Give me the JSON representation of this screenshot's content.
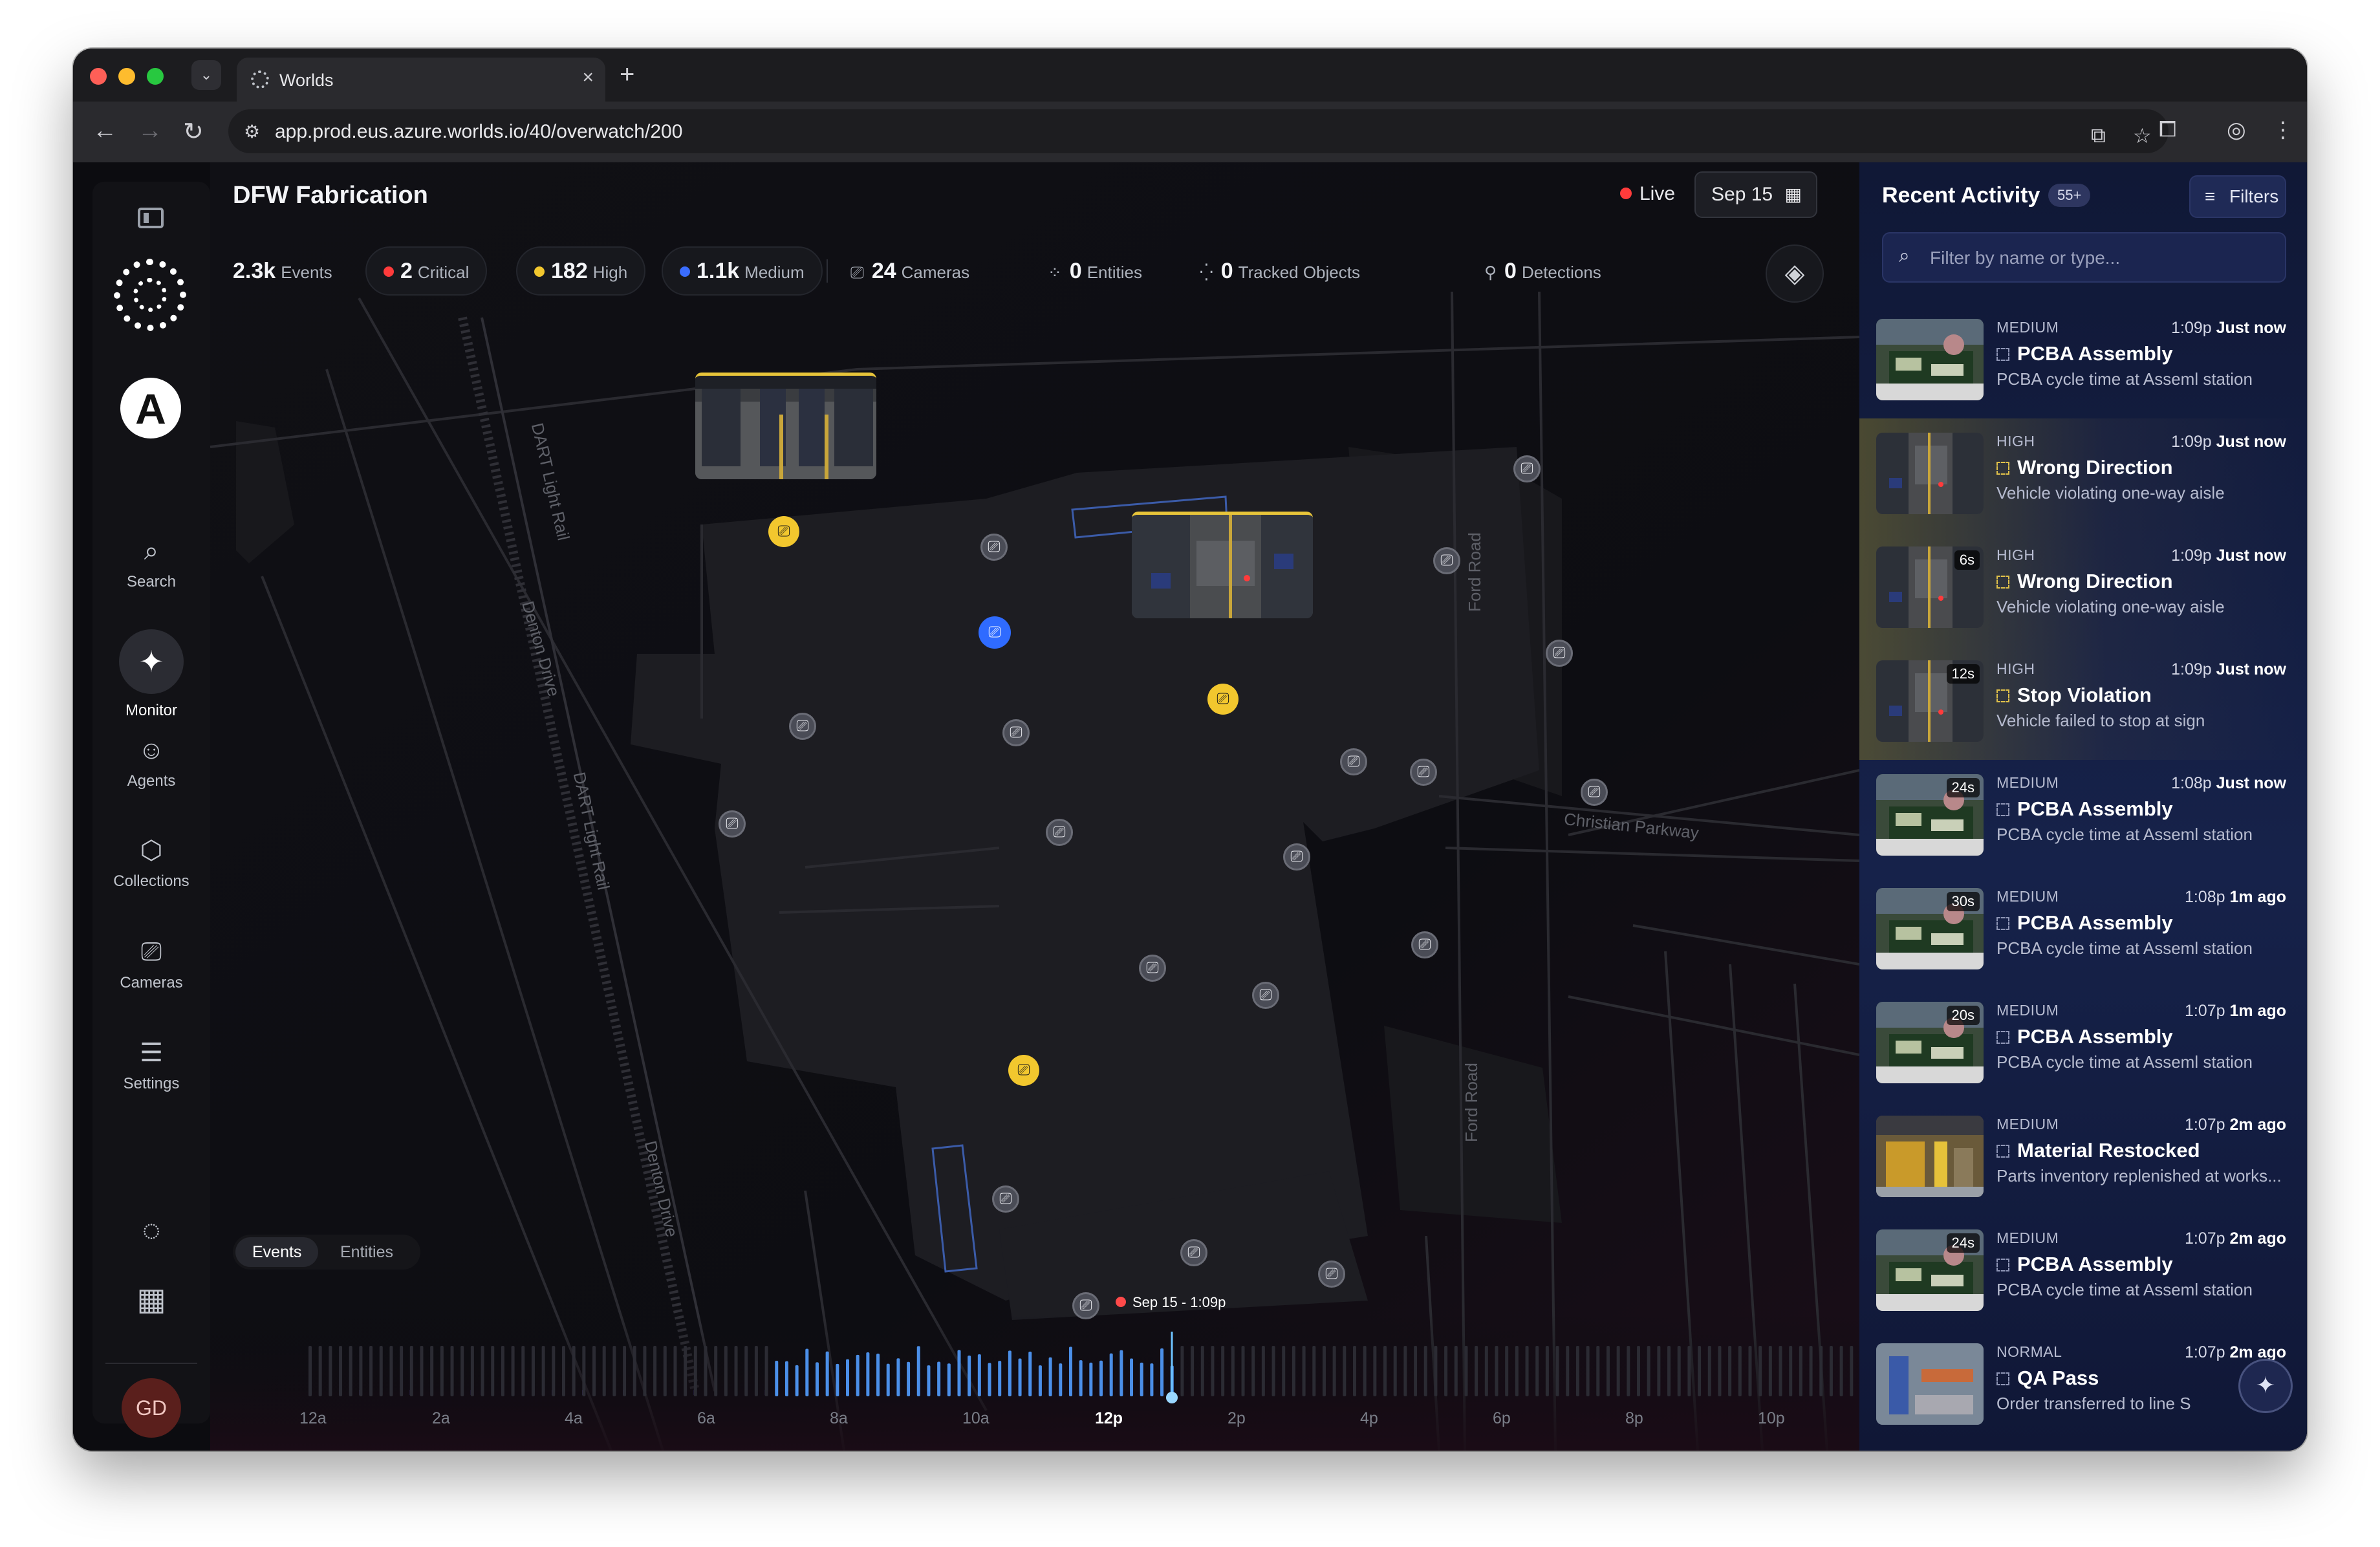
{
  "browser": {
    "tab_title": "Worlds",
    "url": "app.prod.eus.azure.worlds.io/40/overwatch/200"
  },
  "sidebar": {
    "items": [
      {
        "label": "Search",
        "icon": "search-icon"
      },
      {
        "label": "Monitor",
        "icon": "monitor-icon"
      },
      {
        "label": "Agents",
        "icon": "robot-icon"
      },
      {
        "label": "Collections",
        "icon": "collections-icon"
      },
      {
        "label": "Cameras",
        "icon": "camera-icon"
      },
      {
        "label": "Settings",
        "icon": "sliders-icon"
      }
    ],
    "avatar_initials": "GD"
  },
  "map": {
    "title": "DFW Fabrication",
    "live_label": "Live",
    "date": "Sep 15",
    "stats": {
      "events": {
        "value": "2.3k",
        "label": "Events"
      },
      "critical": {
        "value": "2",
        "label": "Critical",
        "color": "#ff3b3b"
      },
      "high": {
        "value": "182",
        "label": "High",
        "color": "#f2c72e"
      },
      "medium": {
        "value": "1.1k",
        "label": "Medium",
        "color": "#3a6dff"
      },
      "cameras": {
        "value": "24",
        "label": "Cameras"
      },
      "entities": {
        "value": "0",
        "label": "Entities"
      },
      "tracked": {
        "value": "0",
        "label": "Tracked Objects"
      },
      "detections": {
        "value": "0",
        "label": "Detections"
      }
    },
    "roads": {
      "dart_rail": "DART Light Rail",
      "denton": "Denton Drive",
      "ford": "Ford Road",
      "christian": "Christian Parkway"
    },
    "toggle": {
      "events": "Events",
      "entities": "Entities"
    },
    "timeline": {
      "cursor_label": "Sep 15 - 1:09p",
      "ticks": [
        "12a",
        "2a",
        "4a",
        "6a",
        "8a",
        "10a",
        "12p",
        "2p",
        "4p",
        "6p",
        "8p",
        "10p"
      ],
      "current_tick": "12p"
    }
  },
  "panel": {
    "title": "Recent Activity",
    "count": "55+",
    "filters_label": "Filters",
    "filter_placeholder": "Filter by name or type...",
    "items": [
      {
        "severity": "MEDIUM",
        "time": "1:09p",
        "ago": "Just now",
        "title": "PCBA Assembly",
        "desc": "PCBA cycle time at Asseml station",
        "duration": "",
        "highlight": false,
        "thumb": "assembly"
      },
      {
        "severity": "HIGH",
        "time": "1:09p",
        "ago": "Just now",
        "title": "Wrong Direction",
        "desc": "Vehicle violating one-way aisle",
        "duration": "",
        "highlight": true,
        "thumb": "warehouse"
      },
      {
        "severity": "HIGH",
        "time": "1:09p",
        "ago": "Just now",
        "title": "Wrong Direction",
        "desc": "Vehicle violating one-way aisle",
        "duration": "6s",
        "highlight": true,
        "thumb": "warehouse"
      },
      {
        "severity": "HIGH",
        "time": "1:09p",
        "ago": "Just now",
        "title": "Stop Violation",
        "desc": "Vehicle failed to stop at sign",
        "duration": "12s",
        "highlight": true,
        "thumb": "warehouse"
      },
      {
        "severity": "MEDIUM",
        "time": "1:08p",
        "ago": "Just now",
        "title": "PCBA Assembly",
        "desc": "PCBA cycle time at Asseml station",
        "duration": "24s",
        "highlight": false,
        "thumb": "assembly"
      },
      {
        "severity": "MEDIUM",
        "time": "1:08p",
        "ago": "1m ago",
        "title": "PCBA Assembly",
        "desc": "PCBA cycle time at Asseml station",
        "duration": "30s",
        "highlight": false,
        "thumb": "assembly"
      },
      {
        "severity": "MEDIUM",
        "time": "1:07p",
        "ago": "1m ago",
        "title": "PCBA Assembly",
        "desc": "PCBA cycle time at Asseml station",
        "duration": "20s",
        "highlight": false,
        "thumb": "assembly"
      },
      {
        "severity": "MEDIUM",
        "time": "1:07p",
        "ago": "2m ago",
        "title": "Material Restocked",
        "desc": "Parts inventory replenished at works...",
        "duration": "",
        "highlight": false,
        "thumb": "shelf"
      },
      {
        "severity": "MEDIUM",
        "time": "1:07p",
        "ago": "2m ago",
        "title": "PCBA Assembly",
        "desc": "PCBA cycle time at Asseml station",
        "duration": "24s",
        "highlight": false,
        "thumb": "assembly"
      },
      {
        "severity": "NORMAL",
        "time": "1:07p",
        "ago": "2m ago",
        "title": "QA Pass",
        "desc": "Order transferred to line S",
        "duration": "",
        "highlight": false,
        "thumb": "conveyor"
      }
    ]
  }
}
